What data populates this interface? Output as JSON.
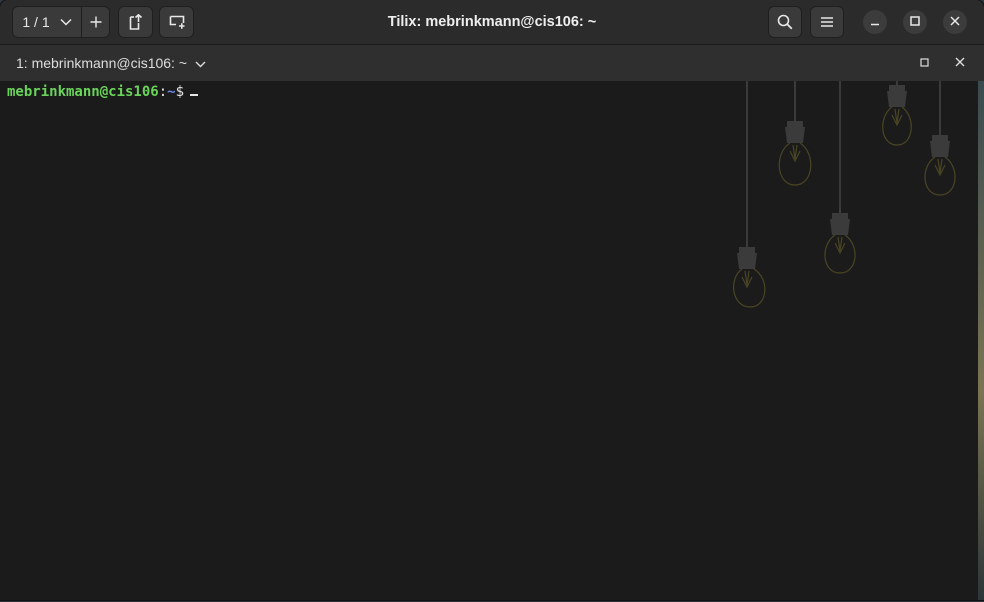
{
  "window": {
    "title": "Tilix: mebrinkmann@cis106: ~"
  },
  "headerbar": {
    "session_counter": "1 / 1",
    "icons": {
      "session_dropdown": "chevron-down-icon",
      "add_session": "plus-icon",
      "split_right": "split-terminal-right-icon",
      "split_down": "split-terminal-down-icon",
      "search": "search-icon",
      "menu": "hamburger-menu-icon",
      "minimize": "minimize-icon",
      "maximize": "maximize-icon",
      "close": "close-icon"
    }
  },
  "terminal_tab": {
    "title": "1: mebrinkmann@cis106: ~"
  },
  "terminal": {
    "user_host": "mebrinkmann@cis106",
    "colon": ":",
    "path": "~",
    "symbol": "$",
    "colors": {
      "user_host": "#6ad35a",
      "path": "#6a86e0",
      "background": "#1b1b1b"
    }
  }
}
